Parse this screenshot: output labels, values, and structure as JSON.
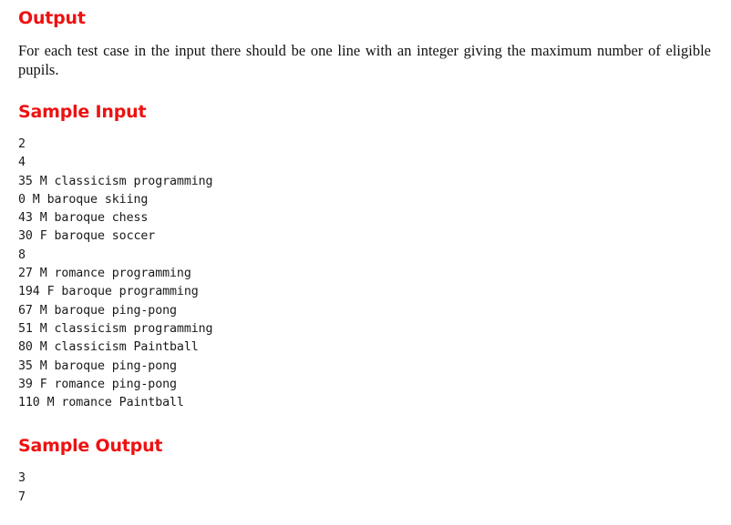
{
  "document": {
    "sections": {
      "output": {
        "heading": "Output",
        "paragraph": "For each test case in the input there should be one line with an integer giving the maximum number of eligible pupils."
      },
      "sample_input": {
        "heading": "Sample Input",
        "lines": [
          "2",
          "4",
          "35 M classicism programming",
          "0 M baroque skiing",
          "43 M baroque chess",
          "30 F baroque soccer",
          "8",
          "27 M romance programming",
          "194 F baroque programming",
          "67 M baroque ping-pong",
          "51 M classicism programming",
          "80 M classicism Paintball",
          "35 M baroque ping-pong",
          "39 F romance ping-pong",
          "110 M romance Paintball"
        ]
      },
      "sample_output": {
        "heading": "Sample Output",
        "lines": [
          "3",
          "7"
        ]
      }
    },
    "colors": {
      "heading": "#ee1111",
      "text": "#1a1a1a",
      "background": "#ffffff"
    }
  }
}
